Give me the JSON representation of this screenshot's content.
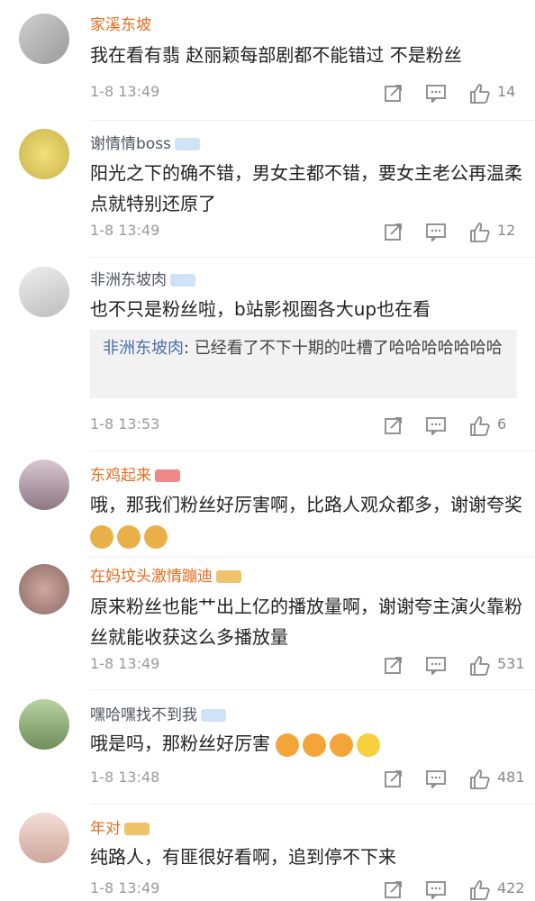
{
  "comments": [
    {
      "user": "家溪东坡",
      "text": "我在看有翡 赵丽颖每部剧都不能错过 不是粉丝",
      "time": "1-8 13:49",
      "likes": "14"
    },
    {
      "user": "谢情情boss",
      "text": "阳光之下的确不错，男女主都不错，要女主老公再温柔点就特别还原了",
      "time": "1-8 13:49",
      "likes": "12"
    },
    {
      "user": "非洲东坡肉",
      "text": "也不只是粉丝啦，b站影视圈各大up也在看",
      "reply_user": "非洲东坡肉",
      "reply_text": ": 已经看了不下十期的吐槽了哈哈哈哈哈哈哈",
      "time": "1-8 13:53",
      "likes": "6"
    },
    {
      "user": "东鸡起来",
      "text": "哦，那我们粉丝好厉害啊，比路人观众都多，谢谢夸奖",
      "time": "",
      "likes": ""
    },
    {
      "user": "在妈坟头激情蹦迪",
      "text": "原来粉丝也能艹出上亿的播放量啊，谢谢夸主演火靠粉丝就能收获这么多播放量",
      "time": "1-8 13:49",
      "likes": "531"
    },
    {
      "user": "嘿哈嘿找不到我",
      "text": "哦是吗，那粉丝好厉害",
      "time": "1-8 13:48",
      "likes": "481"
    },
    {
      "user": "年对",
      "text": "纯路人，有匪很好看啊，追到停不下来",
      "time": "1-8 13:49",
      "likes": "422"
    }
  ]
}
